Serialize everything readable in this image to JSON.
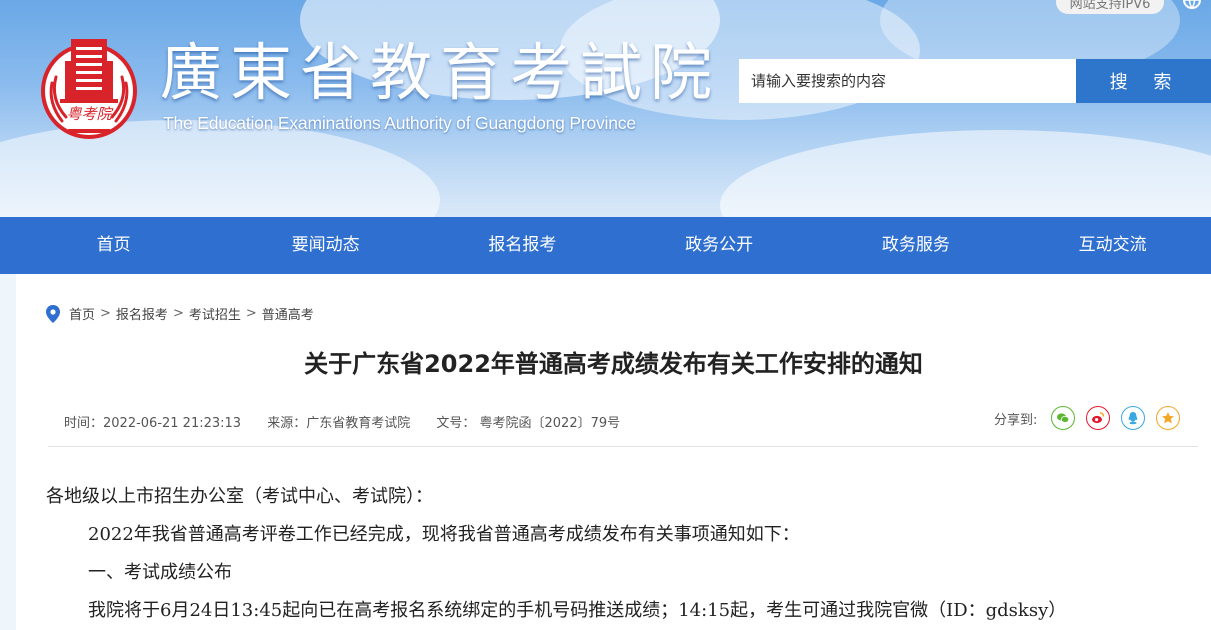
{
  "header": {
    "logo_text": "粤考院",
    "site_title": "廣東省教育考試院",
    "site_subtitle": "The Education Examinations Authority of Guangdong Province",
    "ipv6_badge": "网站支持IPV6",
    "search_placeholder": "请输入要搜索的内容",
    "search_button": "搜 索"
  },
  "nav": {
    "items": [
      {
        "label": "首页"
      },
      {
        "label": "要闻动态"
      },
      {
        "label": "报名报考"
      },
      {
        "label": "政务公开"
      },
      {
        "label": "政务服务"
      },
      {
        "label": "互动交流"
      }
    ]
  },
  "breadcrumb": {
    "items": [
      "首页",
      "报名报考",
      "考试招生",
      "普通高考"
    ],
    "separator": ">"
  },
  "article": {
    "title": "关于广东省2022年普通高考成绩发布有关工作安排的通知",
    "time": "时间：2022-06-21 21:23:13",
    "source": "来源：广东省教育考试院",
    "doc_no": "文号： 粤考院函〔2022〕79号",
    "share_label": "分享到:",
    "share_icons": [
      "wechat-icon",
      "weibo-icon",
      "qq-icon",
      "qzone-icon"
    ],
    "paragraphs": [
      "各地级以上市招生办公室（考试中心、考试院）：",
      "2022年我省普通高考评卷工作已经完成，现将我省普通高考成绩发布有关事项通知如下：",
      "一、考试成绩公布",
      "我院将于6月24日13:45起向已在高考报名系统绑定的手机号码推送成绩；14:15起，考生可通过我院官微（ID：gdsksy）"
    ]
  },
  "colors": {
    "nav_blue": "#2f6fd0",
    "search_blue": "#2e75cc",
    "logo_red": "#d8232a",
    "wechat_green": "#5cb531",
    "weibo_red": "#e6162d",
    "qq_blue": "#3aa8e0",
    "qzone_orange": "#f5a623"
  }
}
